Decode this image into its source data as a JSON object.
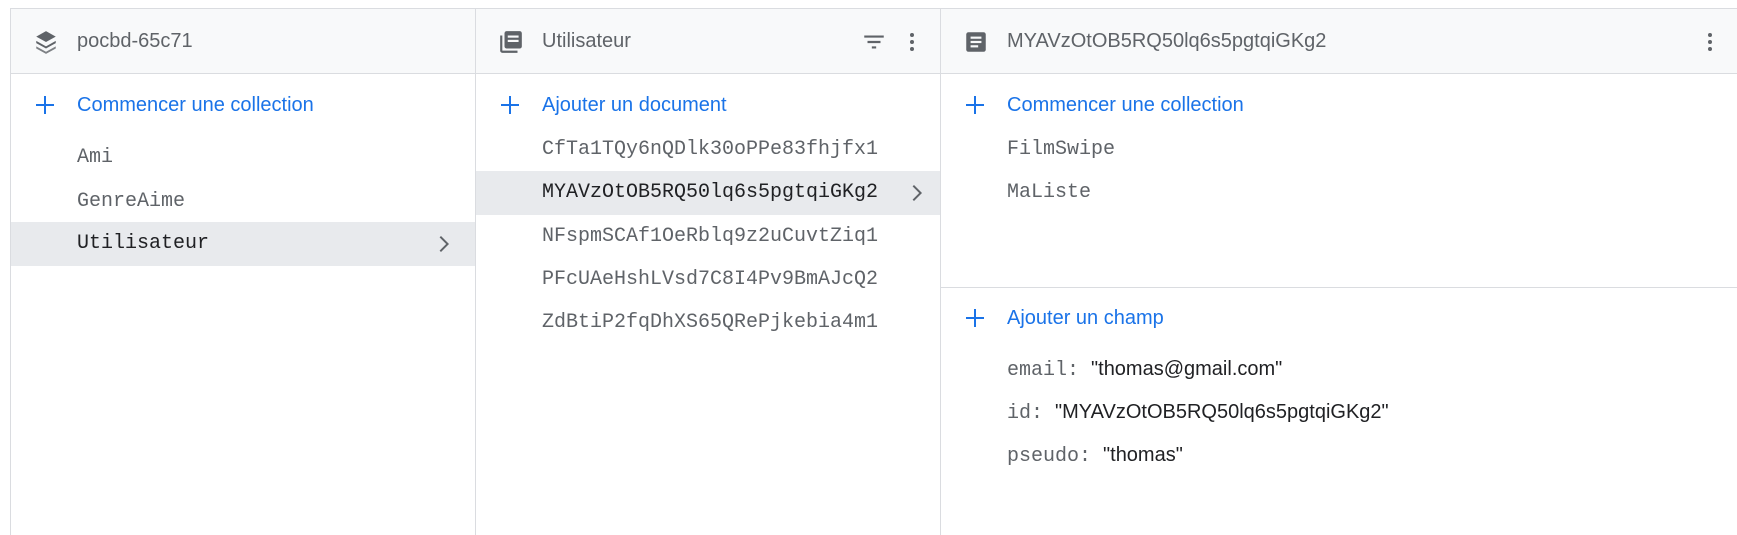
{
  "colors": {
    "accent": "#1a73e8",
    "selected_bg": "#e8eaed",
    "header_bg": "#f8f9fa"
  },
  "root_panel": {
    "title": "pocbd-65c71",
    "icon": "firestore-stack-icon",
    "add_label": "Commencer une collection",
    "items": [
      {
        "label": "Ami"
      },
      {
        "label": "GenreAime"
      },
      {
        "label": "Utilisateur"
      }
    ],
    "selected_index": 2
  },
  "collection_panel": {
    "title": "Utilisateur",
    "icon": "collection-icon",
    "add_label": "Ajouter un document",
    "items": [
      {
        "label": "CfTa1TQy6nQDlk30oPPe83fhjfx1"
      },
      {
        "label": "MYAVzOtOB5RQ50lq6s5pgtqiGKg2"
      },
      {
        "label": "NFspmSCAf1OeRblq9z2uCuvtZiq1"
      },
      {
        "label": "PFcUAeHshLVsd7C8I4Pv9BmAJcQ2"
      },
      {
        "label": "ZdBtiP2fqDhXS65QRePjkebia4m1"
      }
    ],
    "selected_index": 1
  },
  "document_panel": {
    "title": "MYAVzOtOB5RQ50lq6s5pgtqiGKg2",
    "icon": "document-icon",
    "add_collection_label": "Commencer une collection",
    "subcollections": [
      {
        "label": "FilmSwipe"
      },
      {
        "label": "MaListe"
      }
    ],
    "add_field_label": "Ajouter un champ",
    "fields": [
      {
        "key": "email:",
        "value": "\"thomas@gmail.com\""
      },
      {
        "key": "id:",
        "value": "\"MYAVzOtOB5RQ50lq6s5pgtqiGKg2\""
      },
      {
        "key": "pseudo:",
        "value": "\"thomas\""
      }
    ]
  }
}
